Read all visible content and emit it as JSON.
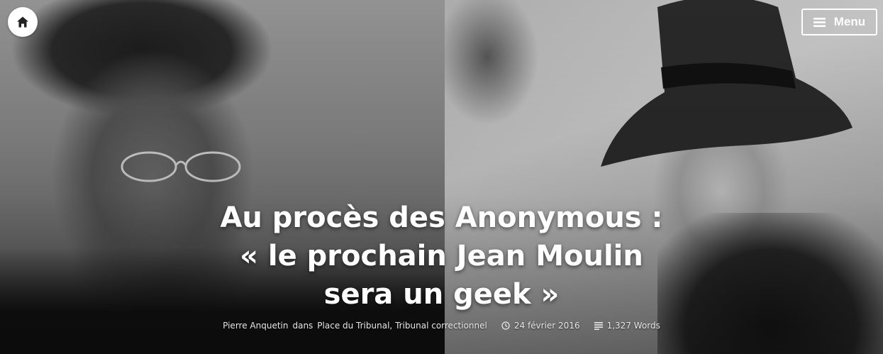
{
  "header": {
    "home_icon": "home-icon",
    "menu_label": "Menu",
    "menu_icon": "hamburger-icon"
  },
  "article": {
    "title_lines": [
      "Au procès des Anonymous :",
      "« le prochain Jean Moulin",
      "sera un geek »"
    ],
    "author": "Pierre Anquetin",
    "in_word": "dans",
    "category_1": "Place du Tribunal",
    "separator": ",",
    "category_2": "Tribunal correctionnel",
    "date": "24 février 2016",
    "date_icon": "clock-icon",
    "word_count": "1,327 Words",
    "word_count_icon": "text-lines-icon"
  },
  "colors": {
    "text": "#ffffff",
    "meta_text": "#e6e6e6",
    "home_bg": "#ffffff"
  }
}
